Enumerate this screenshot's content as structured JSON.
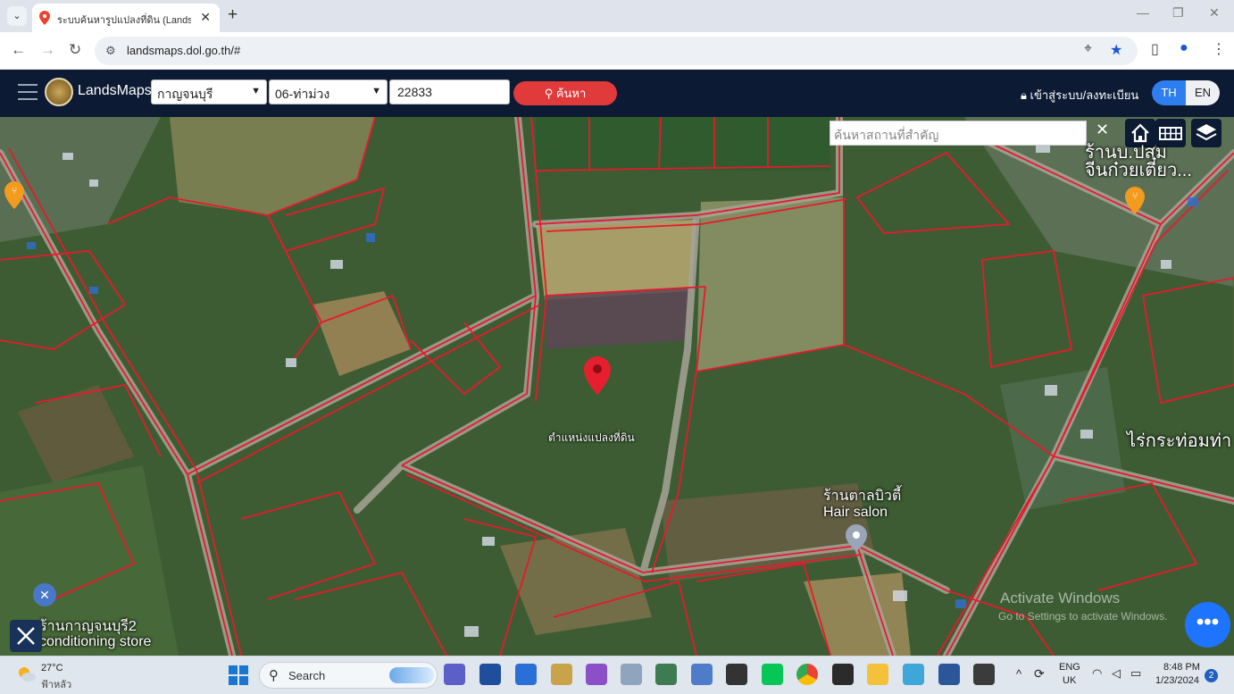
{
  "browser": {
    "tab_title": "ระบบค้นหารูปแปลงที่ดิน (LandsMaps",
    "url": "landsmaps.dol.go.th/#",
    "tab_close": "✕",
    "new_tab": "+"
  },
  "app": {
    "brand": "LandsMaps",
    "province": "กาญจนบุรี",
    "district": "06-ท่าม่วง",
    "parcel_number": "22833",
    "search_button": "ค้นหา",
    "login_label": "เข้าสู่ระบบ/ลงทะเบียน",
    "lang_th": "TH",
    "lang_en": "EN"
  },
  "map": {
    "place_search_placeholder": "ค้นหาสถานที่สำคัญ",
    "clear": "✕",
    "pin_label": "ตำแหน่งแปลงที่ดิน",
    "labels": {
      "shop_top_right_1": "ร้านบ.ปสม",
      "shop_top_right_2": "จีนก๋วยเตี๋ยว...",
      "farm_right": "ไร่กระท่อมท่า",
      "salon_1": "ร้านตาลบิวตี้",
      "salon_2": "Hair salon",
      "store_bottom_1": "ร้านกาญจนบุรี2",
      "store_bottom_2": "conditioning store"
    },
    "watermark_1": "Activate Windows",
    "watermark_2": "Go to Settings to activate Windows.",
    "fab": "•••"
  },
  "taskbar": {
    "temp": "27°C",
    "weather": "ฟ้าหลัว",
    "search": "Search",
    "lang_1": "ENG",
    "lang_2": "UK",
    "time": "8:48 PM",
    "date": "1/23/2024",
    "notifications": "2"
  },
  "colors": {
    "appbar": "#0c1a33",
    "accent_red": "#e03a3a",
    "accent_blue": "#2e7ef0",
    "parcel_line": "#e8192c"
  }
}
